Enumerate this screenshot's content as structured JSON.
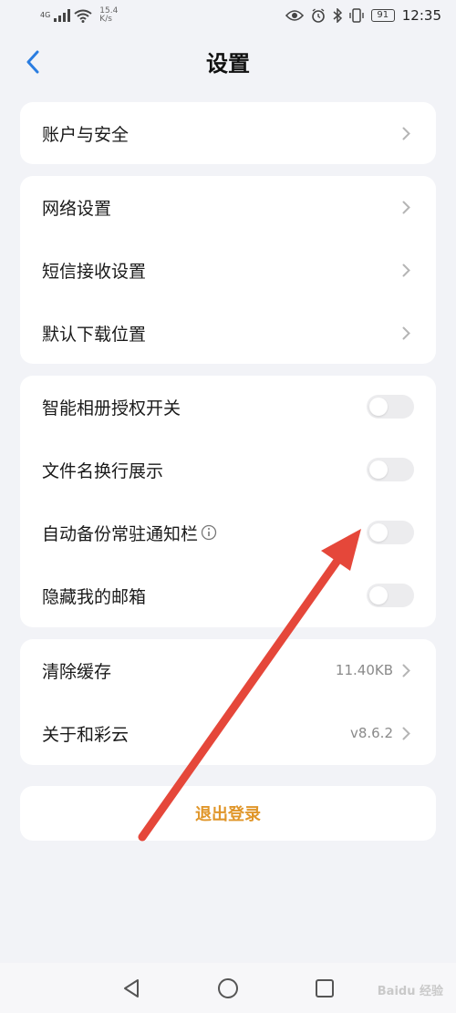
{
  "status_bar": {
    "network_tag": "4G",
    "speed_value": "15.4",
    "speed_unit": "K/s",
    "battery": "91",
    "time": "12:35"
  },
  "header": {
    "title": "设置"
  },
  "groups": [
    {
      "rows": [
        {
          "label": "账户与安全",
          "type": "link"
        }
      ]
    },
    {
      "rows": [
        {
          "label": "网络设置",
          "type": "link"
        },
        {
          "label": "短信接收设置",
          "type": "link"
        },
        {
          "label": "默认下载位置",
          "type": "link"
        }
      ]
    },
    {
      "rows": [
        {
          "label": "智能相册授权开关",
          "type": "toggle",
          "on": false
        },
        {
          "label": "文件名换行展示",
          "type": "toggle",
          "on": false
        },
        {
          "label": "自动备份常驻通知栏",
          "type": "toggle",
          "on": false,
          "info_icon": true
        },
        {
          "label": "隐藏我的邮箱",
          "type": "toggle",
          "on": false
        }
      ]
    },
    {
      "rows": [
        {
          "label": "清除缓存",
          "type": "link",
          "value": "11.40KB"
        },
        {
          "label": "关于和彩云",
          "type": "link",
          "value": "v8.6.2"
        }
      ]
    }
  ],
  "logout": {
    "label": "退出登录"
  },
  "watermark": "Baidu 经验",
  "colors": {
    "accent_blue": "#2a7de1",
    "logout_orange": "#e0962a",
    "annotation_red": "#e5473a",
    "background": "#f2f3f7"
  },
  "icons": {
    "back": "chevron-left-icon",
    "row_arrow": "chevron-right-icon",
    "info": "info-icon",
    "nav_back": "triangle-back-icon",
    "nav_home": "circle-home-icon",
    "nav_recent": "square-recent-icon"
  }
}
